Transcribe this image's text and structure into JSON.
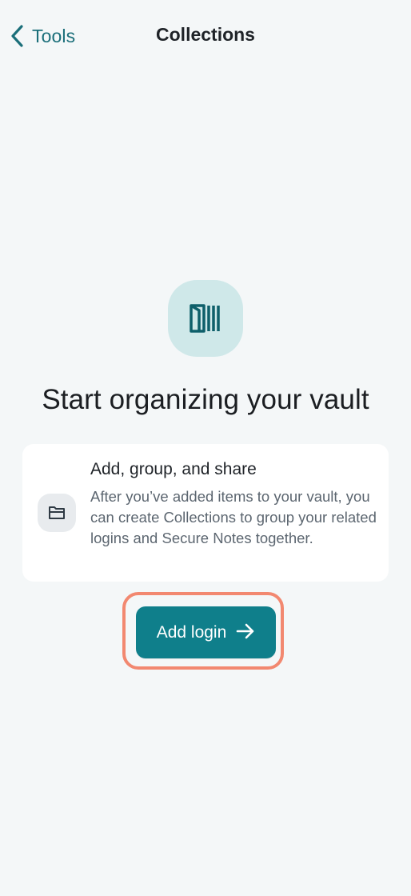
{
  "nav": {
    "back_label": "Tools",
    "title": "Collections"
  },
  "empty_state": {
    "headline": "Start organizing your vault",
    "icon": "collections-icon"
  },
  "info_card": {
    "icon": "folder-icon",
    "title": "Add, group, and share",
    "body": "After you’ve added items to your vault, you can create Collections to group your related logins and Secure Notes together."
  },
  "actions": {
    "primary_label": "Add login",
    "primary_icon": "arrow-right-icon"
  },
  "colors": {
    "accent": "#0f7f8b",
    "nav_accent": "#1b6f7a",
    "hero_bg": "#cfe8e9",
    "highlight": "#f28870",
    "page_bg": "#f4f7f8"
  }
}
